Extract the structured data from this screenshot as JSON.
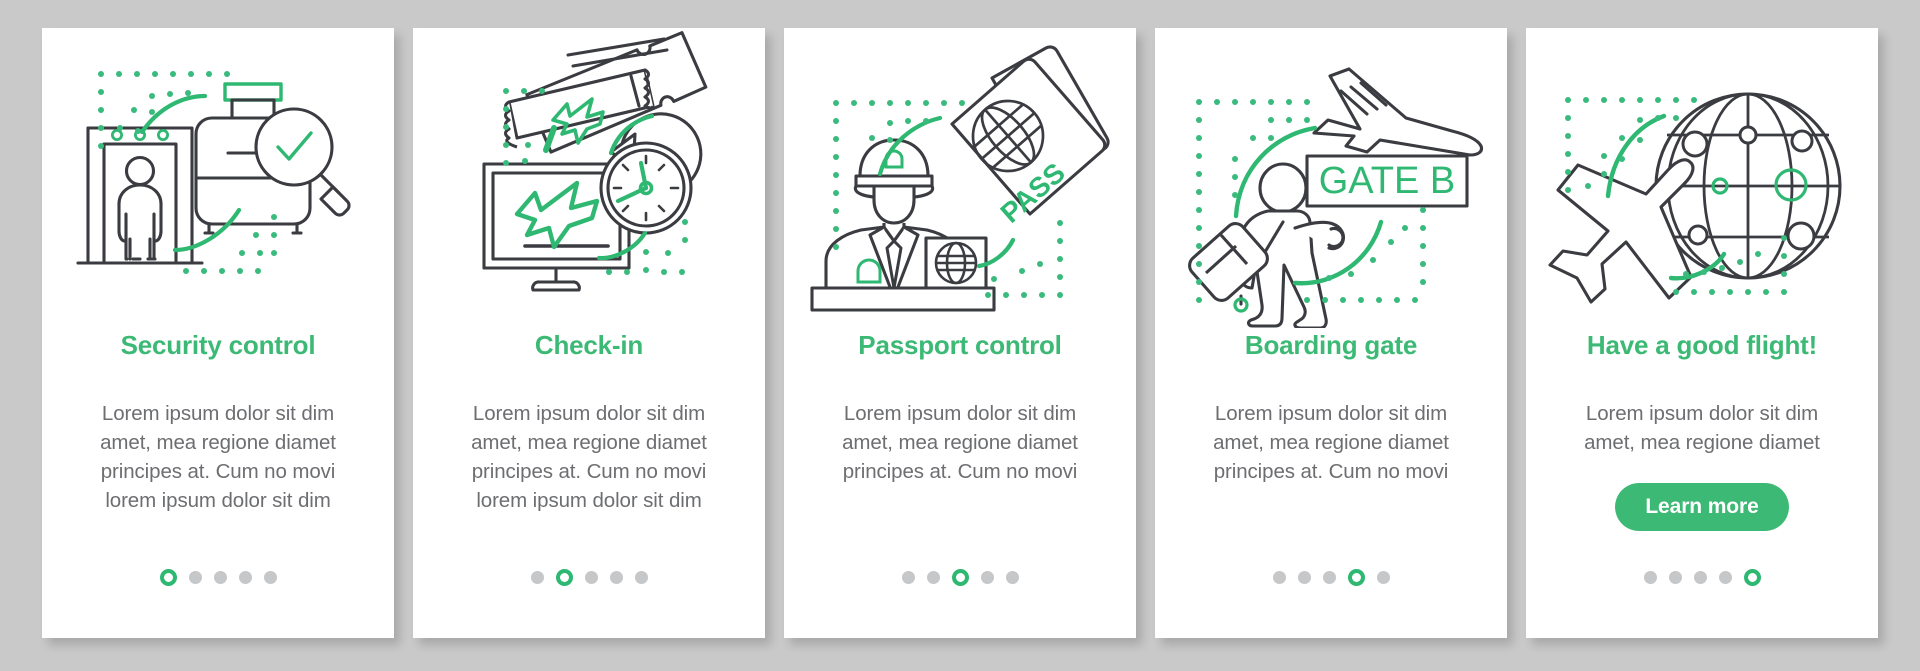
{
  "page": {
    "background_color": "#c9c9c9",
    "card_background": "#ffffff",
    "accent_color": "#3cba75",
    "title_color": "#3cba75",
    "body_text_color": "#6d6e71",
    "dot_inactive_color": "#c6c7c9",
    "dot_active_color": "#2eb872",
    "line_art_color": "#3b3c41"
  },
  "cards": [
    {
      "id": "security-control",
      "title": "Security control",
      "body": "Lorem ipsum dolor sit dim amet, mea regione diamet principes at. Cum no movi lorem ipsum dolor sit dim",
      "illustration": "security-scanner-suitcase-check-illustration",
      "icon_names": [
        "metal-detector-icon",
        "person-icon",
        "suitcase-icon",
        "magnifier-checkmark-icon"
      ],
      "pagination": {
        "total": 5,
        "active_index": 0
      },
      "cta": null
    },
    {
      "id": "check-in",
      "title": "Check-in",
      "body": "Lorem ipsum dolor sit dim amet, mea regione diamet principes at. Cum no movi lorem ipsum dolor sit dim",
      "illustration": "tickets-monitor-clock-illustration",
      "icon_names": [
        "boarding-pass-tickets-icon",
        "departure-monitor-icon",
        "clock-refresh-icon",
        "airplane-icon"
      ],
      "pagination": {
        "total": 5,
        "active_index": 1
      },
      "cta": null
    },
    {
      "id": "passport-control",
      "title": "Passport control",
      "body": "Lorem ipsum dolor sit dim amet, mea regione diamet principes at. Cum no movi",
      "illustration": "officer-passport-desk-illustration",
      "icon_names": [
        "officer-icon",
        "passport-icon",
        "globe-icon",
        "desk-icon"
      ],
      "passport_label": "PASS",
      "pagination": {
        "total": 5,
        "active_index": 2
      },
      "cta": null
    },
    {
      "id": "boarding-gate",
      "title": "Boarding gate",
      "body": "Lorem ipsum dolor sit dim amet, mea regione diamet principes at. Cum no movi",
      "illustration": "traveller-gate-sign-plane-illustration",
      "icon_names": [
        "airplane-icon",
        "gate-sign-icon",
        "traveller-with-luggage-icon"
      ],
      "gate_sign_label": "GATE B",
      "pagination": {
        "total": 5,
        "active_index": 3
      },
      "cta": null
    },
    {
      "id": "have-a-good-flight",
      "title": "Have a good flight!",
      "body": "Lorem ipsum dolor sit dim amet, mea regione diamet",
      "illustration": "globe-airplane-illustration",
      "icon_names": [
        "globe-icon",
        "airplane-icon"
      ],
      "pagination": {
        "total": 5,
        "active_index": 4
      },
      "cta": {
        "label": "Learn more",
        "name": "learn-more-button"
      }
    }
  ]
}
